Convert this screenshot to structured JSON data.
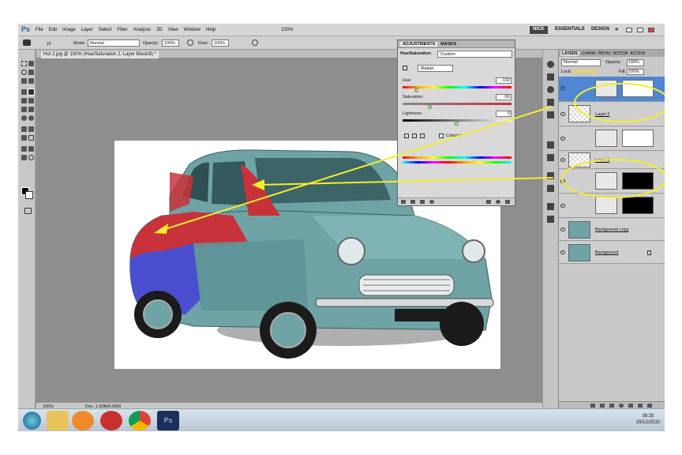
{
  "app": {
    "logo": "Ps",
    "menu": [
      "File",
      "Edit",
      "Image",
      "Layer",
      "Select",
      "Filter",
      "Analysis",
      "3D",
      "View",
      "Window",
      "Help"
    ],
    "zoom": "100%",
    "workspaces": [
      "NICK",
      "ESSENTIALS",
      "DESIGN"
    ],
    "more": "»"
  },
  "options": {
    "brush_size": "10",
    "mode_label": "Mode:",
    "mode_value": "Normal",
    "opacity_label": "Opacity:",
    "opacity_value": "100%",
    "flow_label": "Flow:",
    "flow_value": "100%"
  },
  "document": {
    "tab_title": "Hot 2.jpg @ 100% (Hue/Saturation 2, Layer Mask/8) *",
    "status_zoom": "100%",
    "status_doc": "Doc: 1.69M/6.09M"
  },
  "adjustments": {
    "tabs": [
      "ADJUSTMENTS",
      "MASKS"
    ],
    "title": "Hue/Saturation",
    "preset": "Custom",
    "channel": "Master",
    "hue_label": "Hue:",
    "hue_value": "-132",
    "hue_fraction": 0.13,
    "saturation_label": "Saturation:",
    "saturation_value": "-50",
    "saturation_fraction": 0.25,
    "lightness_label": "Lightness:",
    "lightness_value": "0",
    "lightness_fraction": 0.5,
    "colorize_label": "Colorize"
  },
  "layers": {
    "tabs": [
      "LAYERS",
      "CHANN",
      "PATHS",
      "HISTOR",
      "ACTION"
    ],
    "blend_mode": "Normal",
    "opacity_label": "Opacity:",
    "opacity_value": "100%",
    "lock_label": "Lock:",
    "fill_label": "Fill:",
    "fill_value": "100%",
    "items": [
      {
        "name": "",
        "selected": true
      },
      {
        "name": "Layer 2",
        "selected": false
      },
      {
        "name": "",
        "selected": false
      },
      {
        "name": "Layer 1",
        "selected": false
      },
      {
        "name": "",
        "selected": false
      },
      {
        "name": "",
        "selected": false
      },
      {
        "name": "Background copy",
        "selected": false
      },
      {
        "name": "Background",
        "selected": false
      }
    ]
  },
  "taskbar": {
    "time": "08:35",
    "date": "29/12/2010",
    "ps_label": "Ps"
  },
  "colors": {
    "highlight": "#f3ee2a",
    "selection": "#4f87d2",
    "car_teal": "#6fa3a6",
    "car_red": "#c8323a",
    "car_blue": "#4a4fd0"
  }
}
